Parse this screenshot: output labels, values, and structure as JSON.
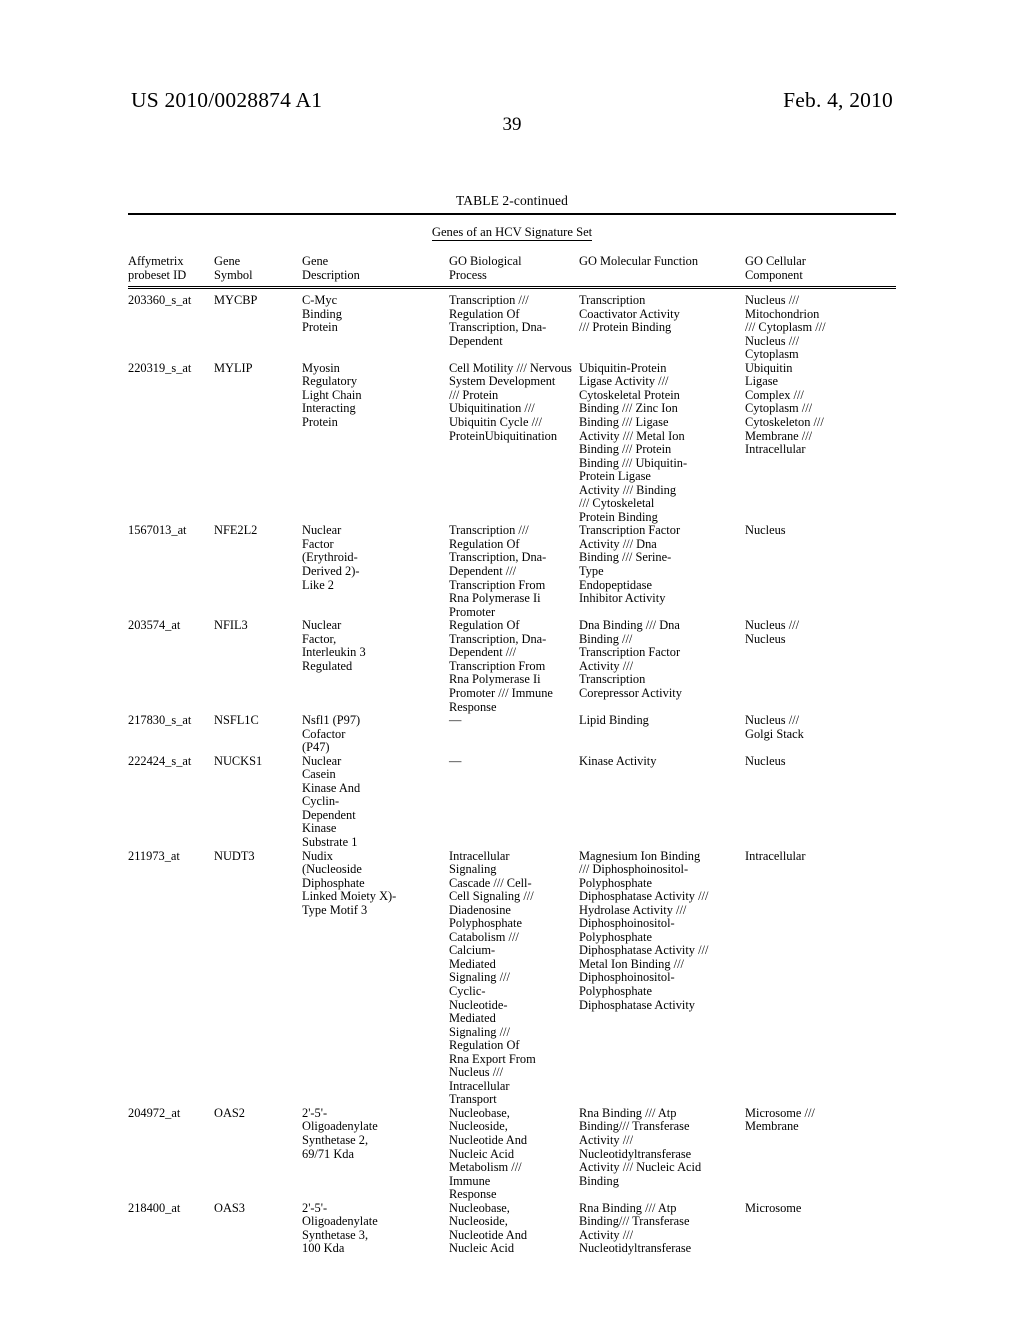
{
  "header": {
    "publication_number": "US 2010/0028874 A1",
    "publication_date": "Feb. 4, 2010",
    "page_number": "39"
  },
  "table": {
    "caption": "TABLE 2-continued",
    "subtitle": "Genes of an HCV Signature Set",
    "columns": [
      {
        "key": "probeset",
        "header": "Affymetrix\nprobeset ID"
      },
      {
        "key": "symbol",
        "header": "Gene\nSymbol"
      },
      {
        "key": "description",
        "header": "Gene\nDescription"
      },
      {
        "key": "process",
        "header": "GO Biological\nProcess"
      },
      {
        "key": "function",
        "header": "GO Molecular Function"
      },
      {
        "key": "component",
        "header": "GO Cellular\nComponent"
      }
    ],
    "rows": [
      {
        "probeset": "203360_s_at",
        "symbol": "MYCBP",
        "description": "C-Myc\nBinding\nProtein",
        "process": "Transcription ///\nRegulation Of\nTranscription, Dna-\nDependent",
        "function": "Transcription\nCoactivator Activity\n/// Protein Binding",
        "component": "Nucleus ///\nMitochondrion\n/// Cytoplasm ///\nNucleus ///\nCytoplasm"
      },
      {
        "probeset": "220319_s_at",
        "symbol": "MYLIP",
        "description": "Myosin\nRegulatory\nLight Chain\nInteracting\nProtein",
        "process": "Cell Motility /// Nervous\nSystem Development\n/// Protein\nUbiquitination ///\nUbiquitin Cycle ///\nProteinUbiquitination",
        "function": "Ubiquitin-Protein\nLigase Activity ///\nCytoskeletal Protein\nBinding /// Zinc Ion\nBinding /// Ligase\nActivity /// Metal Ion\nBinding /// Protein\nBinding /// Ubiquitin-\nProtein Ligase\nActivity /// Binding\n/// Cytoskeletal\nProtein Binding",
        "component": "Ubiquitin\nLigase\nComplex ///\nCytoplasm ///\nCytoskeleton ///\nMembrane ///\nIntracellular"
      },
      {
        "probeset": "1567013_at",
        "symbol": "NFE2L2",
        "description": "Nuclear\nFactor\n(Erythroid-\nDerived 2)-\nLike 2",
        "process": "Transcription ///\nRegulation Of\nTranscription, Dna-\nDependent ///\nTranscription From\nRna Polymerase Ii\nPromoter",
        "function": "Transcription Factor\nActivity /// Dna\nBinding /// Serine-\nType\nEndopeptidase\nInhibitor Activity",
        "component": "Nucleus"
      },
      {
        "probeset": "203574_at",
        "symbol": "NFIL3",
        "description": "Nuclear\nFactor,\nInterleukin 3\nRegulated",
        "process": "Regulation Of\nTranscription, Dna-\nDependent ///\nTranscription From\nRna Polymerase Ii\nPromoter /// Immune\nResponse",
        "function": "Dna Binding /// Dna\nBinding ///\nTranscription Factor\nActivity ///\nTranscription\nCorepressor Activity",
        "component": "Nucleus ///\nNucleus"
      },
      {
        "probeset": "217830_s_at",
        "symbol": "NSFL1C",
        "description": "Nsfl1 (P97)\nCofactor\n(P47)",
        "process": "—",
        "function": "Lipid Binding",
        "component": "Nucleus ///\nGolgi Stack"
      },
      {
        "probeset": "222424_s_at",
        "symbol": "NUCKS1",
        "description": "Nuclear\nCasein\nKinase And\nCyclin-\nDependent\nKinase\nSubstrate 1",
        "process": "—",
        "function": "Kinase Activity",
        "component": "Nucleus"
      },
      {
        "probeset": "211973_at",
        "symbol": "NUDT3",
        "description": "Nudix\n(Nucleoside\nDiphosphate\nLinked Moiety X)-\nType Motif 3",
        "process": "Intracellular\nSignaling\nCascade /// Cell-\nCell Signaling ///\nDiadenosine\nPolyphosphate\nCatabolism ///\nCalcium-\nMediated\nSignaling ///\nCyclic-\nNucleotide-\nMediated\nSignaling ///\nRegulation Of\nRna Export From\nNucleus ///\nIntracellular\nTransport",
        "function": "Magnesium Ion Binding\n/// Diphosphoinositol-\nPolyphosphate\nDiphosphatase Activity ///\nHydrolase Activity ///\nDiphosphoinositol-\nPolyphosphate\nDiphosphatase Activity ///\nMetal Ion Binding ///\nDiphosphoinositol-\nPolyphosphate\nDiphosphatase Activity",
        "component": "Intracellular"
      },
      {
        "probeset": "204972_at",
        "symbol": "OAS2",
        "description": "2'-5'-\nOligoadenylate\nSynthetase 2,\n69/71 Kda",
        "process": "Nucleobase,\nNucleoside,\nNucleotide And\nNucleic Acid\nMetabolism ///\nImmune\nResponse",
        "function": "Rna Binding /// Atp\nBinding/// Transferase\nActivity ///\nNucleotidyltransferase\nActivity /// Nucleic Acid\nBinding",
        "component": "Microsome ///\nMembrane"
      },
      {
        "probeset": "218400_at",
        "symbol": "OAS3",
        "description": "2'-5'-\nOligoadenylate\nSynthetase 3,\n100 Kda",
        "process": "Nucleobase,\nNucleoside,\nNucleotide And\nNucleic Acid",
        "function": "Rna Binding /// Atp\nBinding/// Transferase\nActivity ///\nNucleotidyltransferase",
        "component": "Microsome"
      }
    ]
  }
}
